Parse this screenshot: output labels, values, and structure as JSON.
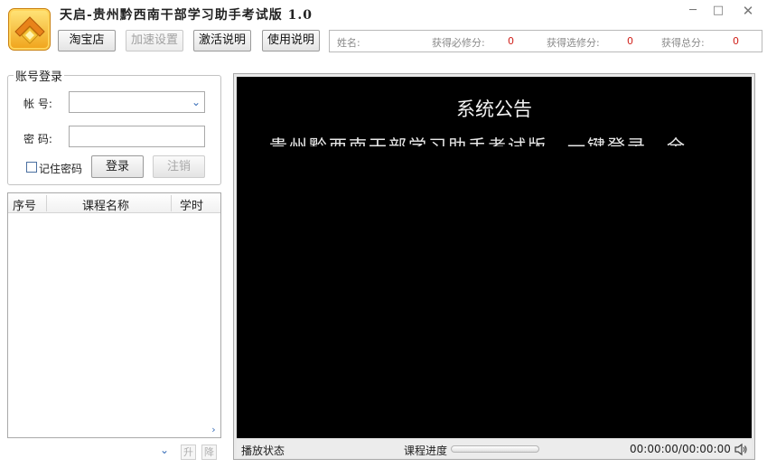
{
  "window": {
    "title": "天启-贵州黔西南干部学习助手考试版 1.0",
    "controls": {
      "minimize": "─",
      "maximize": "□",
      "close": "✕"
    }
  },
  "toolbar": {
    "taobao": "淘宝店",
    "speed_settings": "加速设置",
    "activation_help": "激活说明",
    "usage_help": "使用说明"
  },
  "info": {
    "name_label": "姓名:",
    "name_value": "",
    "required_label": "获得必修分:",
    "required_value": "0",
    "elective_label": "获得选修分:",
    "elective_value": "0",
    "total_label": "获得总分:",
    "total_value": "0"
  },
  "login": {
    "group_title": "账号登录",
    "account_label": "帐  号:",
    "account_value": "",
    "password_label": "密  码:",
    "password_value": "",
    "remember_label": "记住密码",
    "remember_checked": false,
    "login_button": "登录",
    "logout_button": "注销"
  },
  "courses": {
    "columns": [
      "序号",
      "课程名称",
      "学时"
    ],
    "rows": []
  },
  "sort": {
    "up": "升",
    "down": "降"
  },
  "notice": {
    "title": "系统公告",
    "body": "贵州黔西南干部学习助手考试版，一键登录，全"
  },
  "player": {
    "status_label": "播放状态",
    "progress_label": "课程进度",
    "progress_fraction": 0,
    "time": "00:00:00/00:00:00"
  },
  "icons": {
    "logo": "app-logo-icon",
    "volume": "speaker-icon",
    "dropdown": "chevron-down-icon",
    "scroll_right": "chevron-right-icon"
  },
  "colors": {
    "score_value": "#d0201a",
    "screen_background": "#000000",
    "accent_blue": "#3a6fb8"
  }
}
